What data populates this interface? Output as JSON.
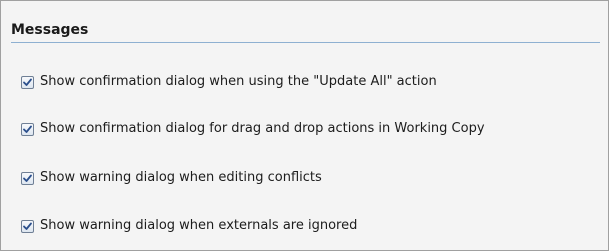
{
  "messages_group": {
    "title": "Messages",
    "options": [
      {
        "label": "Show confirmation dialog when using the \"Update All\" action",
        "checked": true
      },
      {
        "label": "Show confirmation dialog for drag and drop actions in Working Copy",
        "checked": true
      },
      {
        "label": "Show warning dialog when editing conflicts",
        "checked": true
      },
      {
        "label": "Show warning dialog when externals are ignored",
        "checked": true
      }
    ]
  },
  "colors": {
    "rule": "#8eb0d1",
    "check": "#2b4f8c",
    "panel": "#f4f4f4"
  },
  "icons": {
    "checkbox": "checkmark-icon"
  }
}
